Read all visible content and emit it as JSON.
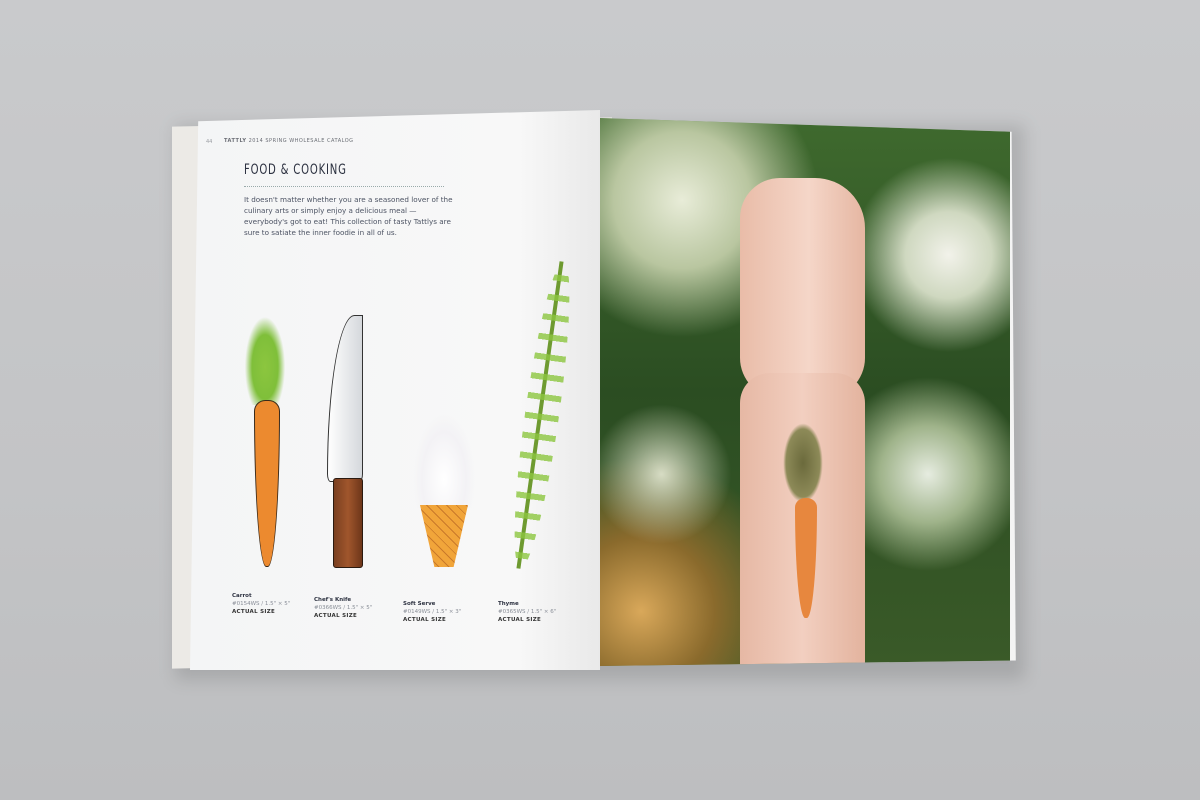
{
  "catalog_header": {
    "page_number": "44",
    "brand": "TATTLY",
    "title": "2014 SPRING WHOLESALE CATALOG"
  },
  "section": {
    "title": "FOOD & COOKING",
    "intro": "It doesn't matter whether you are a seasoned lover of the culinary arts or simply enjoy a delicious meal — everybody's got to eat! This collection of tasty Tattlys are sure to satiate the inner foodie in all of us."
  },
  "products": [
    {
      "name": "Carrot",
      "sku": "#0154WS / 1.5\" × 5\"",
      "size_note": "ACTUAL SIZE"
    },
    {
      "name": "Chef's Knife",
      "sku": "#0366WS / 1.5\" × 5\"",
      "size_note": "ACTUAL SIZE"
    },
    {
      "name": "Soft Serve",
      "sku": "#0149WS / 1.5\" × 3\"",
      "size_note": "ACTUAL SIZE"
    },
    {
      "name": "Thyme",
      "sku": "#0365WS / 1.5\" × 6\"",
      "size_note": "ACTUAL SIZE"
    }
  ]
}
